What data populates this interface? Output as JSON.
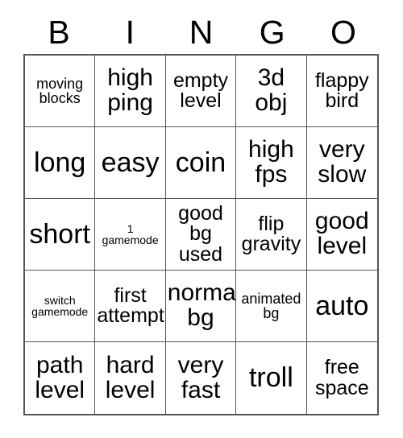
{
  "card": {
    "title": "BINGO",
    "header_letters": [
      "B",
      "I",
      "N",
      "G",
      "O"
    ],
    "grid_size": "5x5",
    "border_color": "#555555",
    "background_color": "#ffffff",
    "text_color": "#000000",
    "cells": [
      {
        "text": "moving\nblocks",
        "size": "sm",
        "row": 1,
        "col": 1
      },
      {
        "text": "high\nping",
        "size": "lg",
        "row": 1,
        "col": 2
      },
      {
        "text": "empty\nlevel",
        "size": "md",
        "row": 1,
        "col": 3
      },
      {
        "text": "3d\nobj",
        "size": "lg",
        "row": 1,
        "col": 4
      },
      {
        "text": "flappy\nbird",
        "size": "md",
        "row": 1,
        "col": 5
      },
      {
        "text": "long",
        "size": "xl",
        "row": 2,
        "col": 1
      },
      {
        "text": "easy",
        "size": "xl",
        "row": 2,
        "col": 2
      },
      {
        "text": "coin",
        "size": "xl",
        "row": 2,
        "col": 3
      },
      {
        "text": "high\nfps",
        "size": "lg",
        "row": 2,
        "col": 4
      },
      {
        "text": "very\nslow",
        "size": "lg",
        "row": 2,
        "col": 5
      },
      {
        "text": "short",
        "size": "xl",
        "row": 3,
        "col": 1
      },
      {
        "text": "1\ngamemode",
        "size": "xs",
        "row": 3,
        "col": 2
      },
      {
        "text": "good\nbg\nused",
        "size": "md",
        "row": 3,
        "col": 3
      },
      {
        "text": "flip\ngravity",
        "size": "md",
        "row": 3,
        "col": 4
      },
      {
        "text": "good\nlevel",
        "size": "lg",
        "row": 3,
        "col": 5
      },
      {
        "text": "switch\ngamemode",
        "size": "xs",
        "row": 4,
        "col": 1
      },
      {
        "text": "first\nattempt",
        "size": "md",
        "row": 4,
        "col": 2
      },
      {
        "text": "normal\nbg",
        "size": "lg",
        "row": 4,
        "col": 3
      },
      {
        "text": "animated\nbg",
        "size": "sm",
        "row": 4,
        "col": 4
      },
      {
        "text": "auto",
        "size": "xl",
        "row": 4,
        "col": 5
      },
      {
        "text": "path\nlevel",
        "size": "lg",
        "row": 5,
        "col": 1
      },
      {
        "text": "hard\nlevel",
        "size": "lg",
        "row": 5,
        "col": 2
      },
      {
        "text": "very\nfast",
        "size": "lg",
        "row": 5,
        "col": 3
      },
      {
        "text": "troll",
        "size": "xl",
        "row": 5,
        "col": 4
      },
      {
        "text": "free\nspace",
        "size": "md",
        "row": 5,
        "col": 5
      }
    ]
  }
}
